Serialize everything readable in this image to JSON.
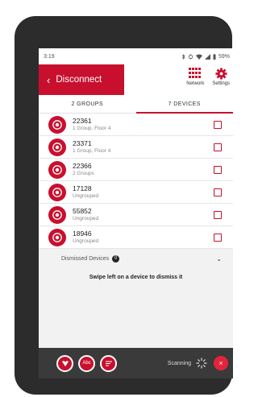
{
  "status": {
    "time": "3:19",
    "battery": "59%"
  },
  "header": {
    "back_label": "Disconnect",
    "network_label": "Network",
    "settings_label": "Settings"
  },
  "tabs": [
    {
      "label": "2 GROUPS"
    },
    {
      "label": "7 DEVICES"
    }
  ],
  "devices": [
    {
      "name": "22361",
      "sub": "1 Group, Floor 4"
    },
    {
      "name": "23371",
      "sub": "1 Group, Floor 4"
    },
    {
      "name": "22366",
      "sub": "2 Groups"
    },
    {
      "name": "17128",
      "sub": "Ungrouped"
    },
    {
      "name": "55852",
      "sub": "Ungrouped"
    },
    {
      "name": "18946",
      "sub": "Ungrouped"
    }
  ],
  "dismissed": {
    "label": "Dismissed Devices",
    "count": "0"
  },
  "hint": "Swipe left on a device to dismiss it",
  "bottom": {
    "abc_label": "Abc",
    "scanning_label": "Scanning",
    "close_symbol": "×"
  },
  "colors": {
    "accent": "#c8102e",
    "bottom_bar": "#3a3a3a"
  }
}
